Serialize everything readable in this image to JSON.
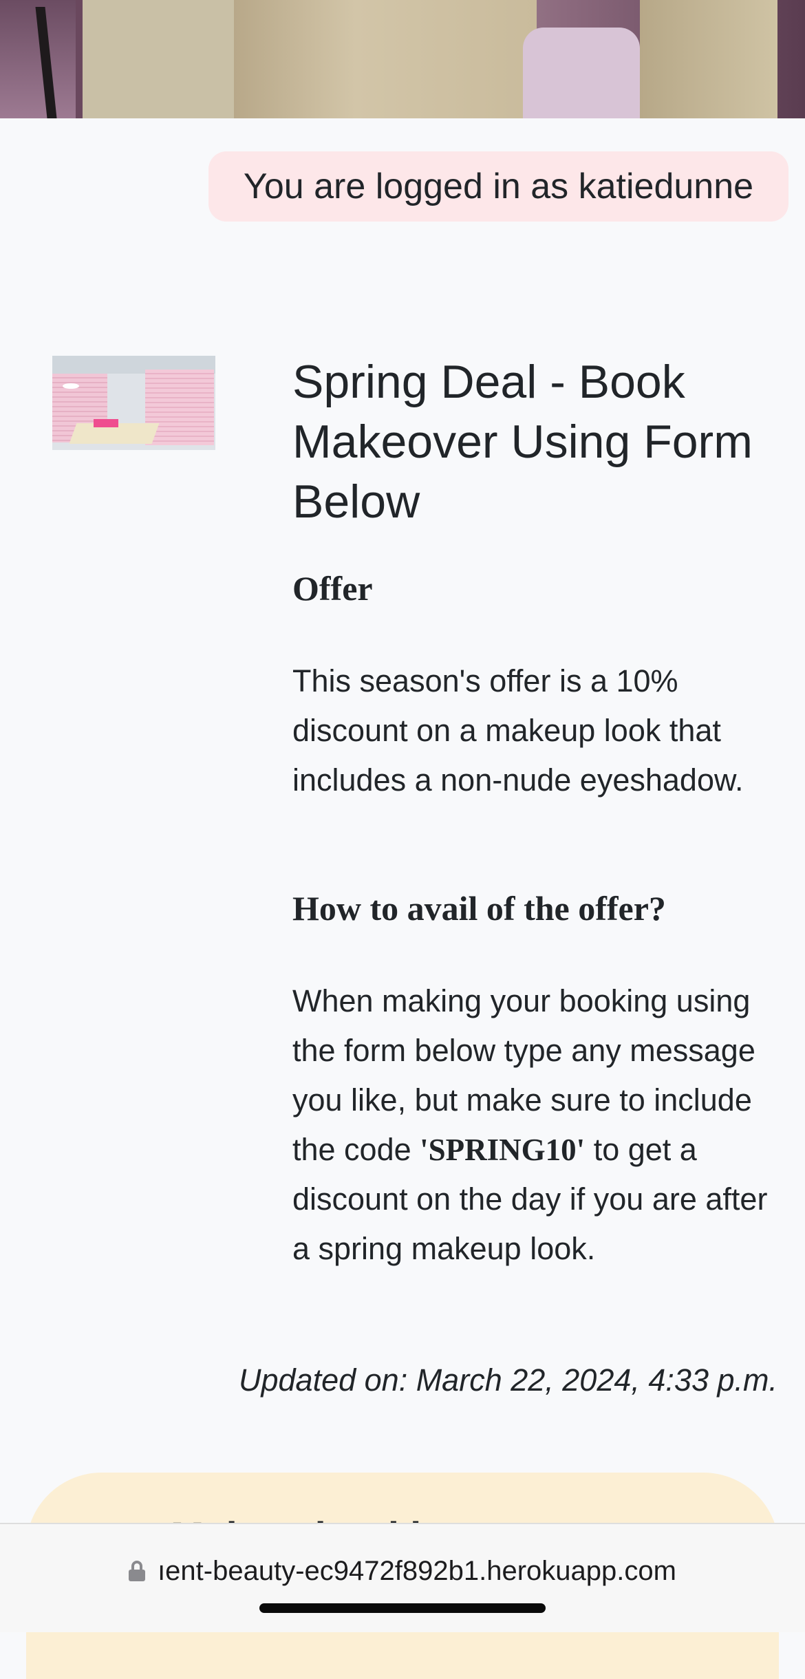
{
  "login": {
    "text": "You are logged in as katiedunne"
  },
  "post": {
    "title": "Spring Deal - Book Makeover Using Form Below",
    "offer_heading": "Offer",
    "offer_text": "This season's offer is a 10% discount on a makeup look that includes a non-nude eyeshadow.",
    "howto_heading": "How to avail of the offer?",
    "howto_before": "When making your booking using the form below type any message you like, but make sure to include the code ",
    "howto_code": "'SPRING10'",
    "howto_after": " to get a discount on the day if you are after a spring makeup look.",
    "updated": "Updated on: March 22, 2024, 4:33 p.m."
  },
  "booking_card": {
    "title": "Make a booking"
  },
  "browser": {
    "url": "ıent-beauty-ec9472f892b1.herokuapp.com"
  },
  "icons": {
    "lock": "lock-icon"
  },
  "colors": {
    "login_badge_bg": "#fde7e9",
    "card_bg": "#fcefd4",
    "page_bg": "#f8f9fb"
  }
}
